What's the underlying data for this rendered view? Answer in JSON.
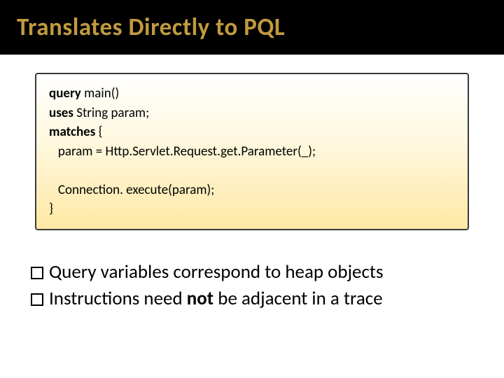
{
  "title": "Translates Directly to PQL",
  "code": {
    "l1_kw": "query",
    "l1_rest": " main()",
    "l2_kw": "uses",
    "l2_rest": " String param;",
    "l3_kw": "matches",
    "l3_rest": " {",
    "l4": "   param = Http.Servlet.Request.get.Parameter(_);",
    "l5": "   Connection. execute(param);",
    "l6": "}"
  },
  "bullets": {
    "b1_a": "Query variables correspond to heap objects",
    "b2_a": "Instructions need ",
    "b2_b": "not",
    "b2_c": " be adjacent in a trace"
  }
}
